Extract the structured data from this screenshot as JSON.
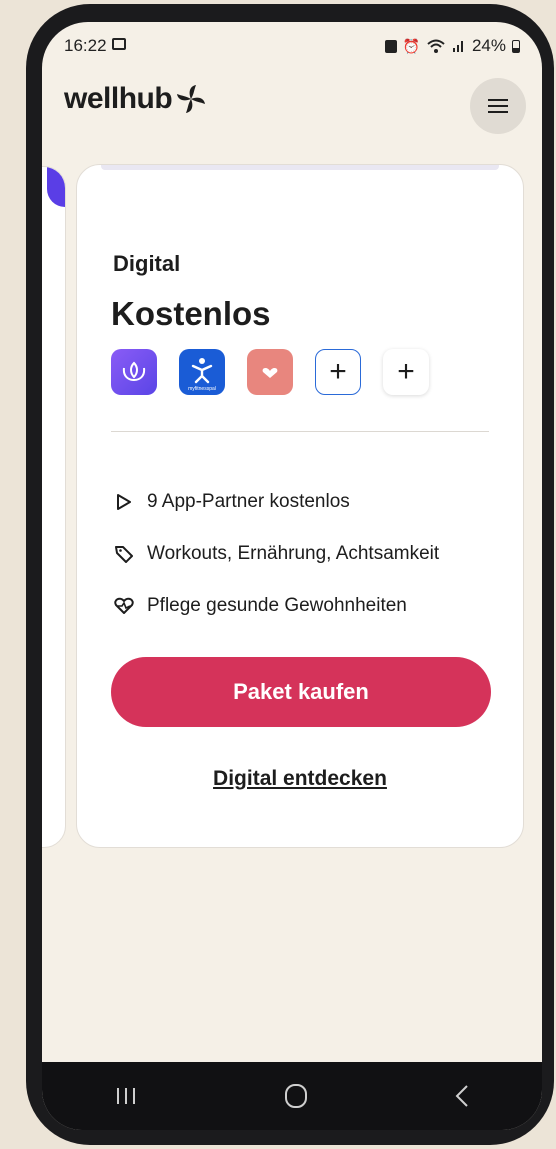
{
  "status_bar": {
    "time": "16:22",
    "battery": "24%"
  },
  "header": {
    "logo_text": "wellhub",
    "logo_color": "#1d1d1d",
    "menu_icon": "hamburger-icon"
  },
  "card": {
    "tier": "Digital",
    "price": "Kostenlos",
    "apps": [
      {
        "name": "calm-app-icon"
      },
      {
        "name": "myfitnesspal-app-icon",
        "label": "myfitnesspal"
      },
      {
        "name": "heart-app-icon"
      },
      {
        "name": "plus-icon",
        "label": "+"
      },
      {
        "name": "plus-icon",
        "label": "+"
      }
    ],
    "features": [
      {
        "icon": "play-icon",
        "text": "9 App-Partner kostenlos"
      },
      {
        "icon": "tag-icon",
        "text": "Workouts, Ernährung, Achtsamkeit"
      },
      {
        "icon": "heartbeat-icon",
        "text": "Pflege gesunde Gewohnheiten"
      }
    ],
    "buy_button": "Paket kaufen",
    "explore_link": "Digital entdecken",
    "accent_color": "#d5335a"
  },
  "nav": {
    "items": [
      "recent-apps-icon",
      "home-icon",
      "back-icon"
    ]
  }
}
